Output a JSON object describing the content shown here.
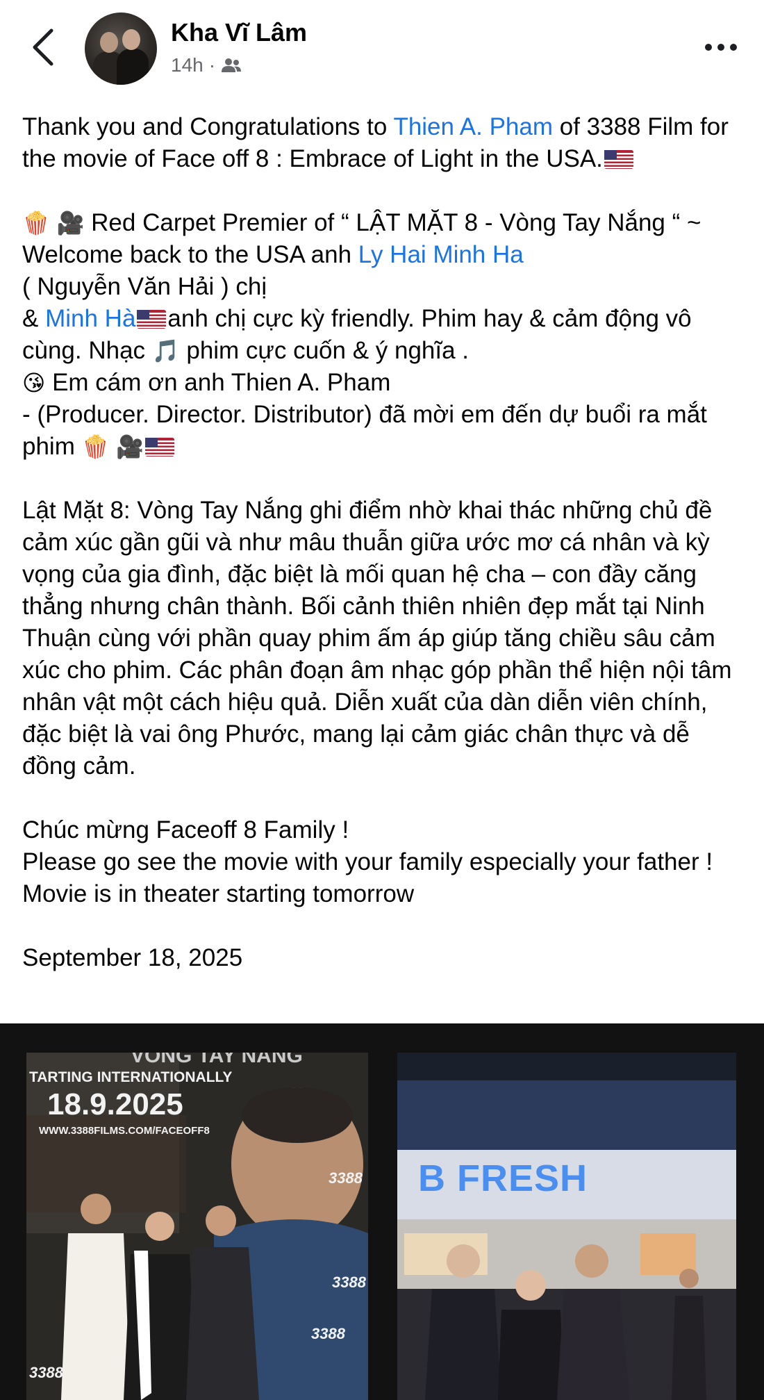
{
  "header": {
    "author": "Kha Vĩ Lâm",
    "time": "14h",
    "separator": "·",
    "audience_icon": "friends-icon"
  },
  "post": {
    "p1": {
      "a": "Thank you and Congratulations to ",
      "link": "Thien A. Pham",
      "b": " of 3388 Film for the movie of Face off 8 : Embrace of Light in the USA."
    },
    "p2": {
      "emoji1": "🍿",
      "emoji2": "🎥",
      "a": " Red Carpet Premier of “ LẬT MẶT 8 - Vòng Tay Nắng “ ~ Welcome back to the USA anh ",
      "link1": "Ly Hai Minh Ha",
      "b": "\n( Nguyễn Văn Hải ) chị\n& ",
      "link2": "Minh Hà",
      "c": "anh chị cực kỳ friendly. Phim hay & cảm động vô cùng. Nhạc ",
      "music": "🎵",
      "d": " phim cực cuốn & ý nghĩa .\n",
      "kiss": "😘",
      "e": " Em cám ơn anh Thien A. Pham\n- (Producer. Director. Distributor) đã mời em đến dự buổi ra mắt phim ",
      "emoji3": "🍿",
      "emoji4": "🎥"
    },
    "p3": "Lật Mặt 8: Vòng Tay Nắng ghi điểm nhờ khai thác những chủ đề cảm xúc gần gũi và như mâu thuẫn giữa ước mơ cá nhân và kỳ vọng của gia đình, đặc biệt là mối quan hệ cha – con đầy căng thẳng nhưng chân thành. Bối cảnh thiên nhiên đẹp mắt tại Ninh Thuận cùng với phần quay phim ấm áp giúp tăng chiều sâu cảm xúc cho phim. Các phân đoạn âm nhạc góp phần thể hiện nội tâm nhân vật một cách hiệu quả. Diễn xuất của dàn diễn viên chính, đặc biệt là vai ông Phước, mang lại cảm giác chân thực và dễ đồng cảm.",
    "p4_line1": "Chúc mừng Faceoff 8 Family !",
    "p4_line2": "Please go see the movie with your family especially your father ! Movie is in theater starting tomorrow",
    "date": "September 18, 2025"
  },
  "photo1": {
    "top_text": "VÒNG TAY NẮNG",
    "starting": "TARTING INTERNATIONALLY",
    "date": "18.9.2025",
    "url": "WWW.3388FILMS.COM/FACEOFF8",
    "logo": "3388"
  },
  "photo2": {
    "sign": "B FRESH"
  },
  "colors": {
    "link": "#1b74e4",
    "meta": "#65676b",
    "text": "#050505"
  }
}
